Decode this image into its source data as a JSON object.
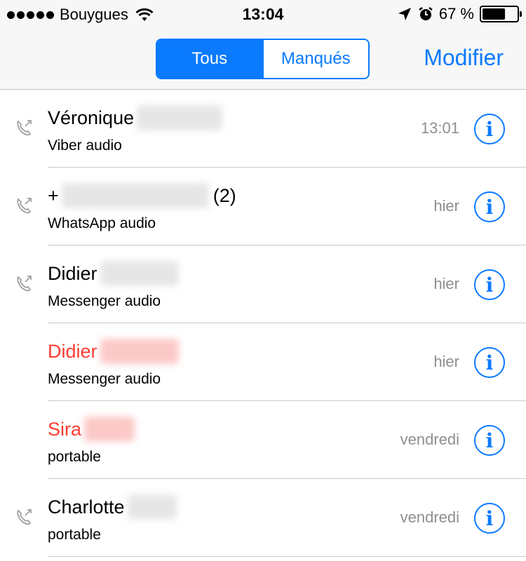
{
  "status_bar": {
    "carrier": "Bouygues",
    "time": "13:04",
    "battery_text": "67 %",
    "battery_level": 0.67,
    "icons": [
      "signal-dots-icon",
      "wifi-icon",
      "location-arrow-icon",
      "alarm-clock-icon",
      "battery-icon"
    ]
  },
  "nav": {
    "segments": [
      {
        "label": "Tous",
        "selected": true
      },
      {
        "label": "Manqués",
        "selected": false
      }
    ],
    "edit_label": "Modifier"
  },
  "colors": {
    "accent": "#0a7aff",
    "missed": "#ff3b30",
    "secondary_text": "#8e8e93",
    "separator": "#c8c7cc"
  },
  "calls": [
    {
      "name": "Véronique",
      "suffix": "",
      "type": "Viber audio",
      "time": "13:01",
      "missed": false,
      "outgoing": true
    },
    {
      "name": "+",
      "suffix": "(2)",
      "type": "WhatsApp audio",
      "time": "hier",
      "missed": false,
      "outgoing": true
    },
    {
      "name": "Didier",
      "suffix": "",
      "type": "Messenger audio",
      "time": "hier",
      "missed": false,
      "outgoing": true
    },
    {
      "name": "Didier",
      "suffix": "",
      "type": "Messenger audio",
      "time": "hier",
      "missed": true,
      "outgoing": false
    },
    {
      "name": "Sira",
      "suffix": "",
      "type": "portable",
      "time": "vendredi",
      "missed": true,
      "outgoing": false
    },
    {
      "name": "Charlotte",
      "suffix": "",
      "type": "portable",
      "time": "vendredi",
      "missed": false,
      "outgoing": true
    }
  ]
}
